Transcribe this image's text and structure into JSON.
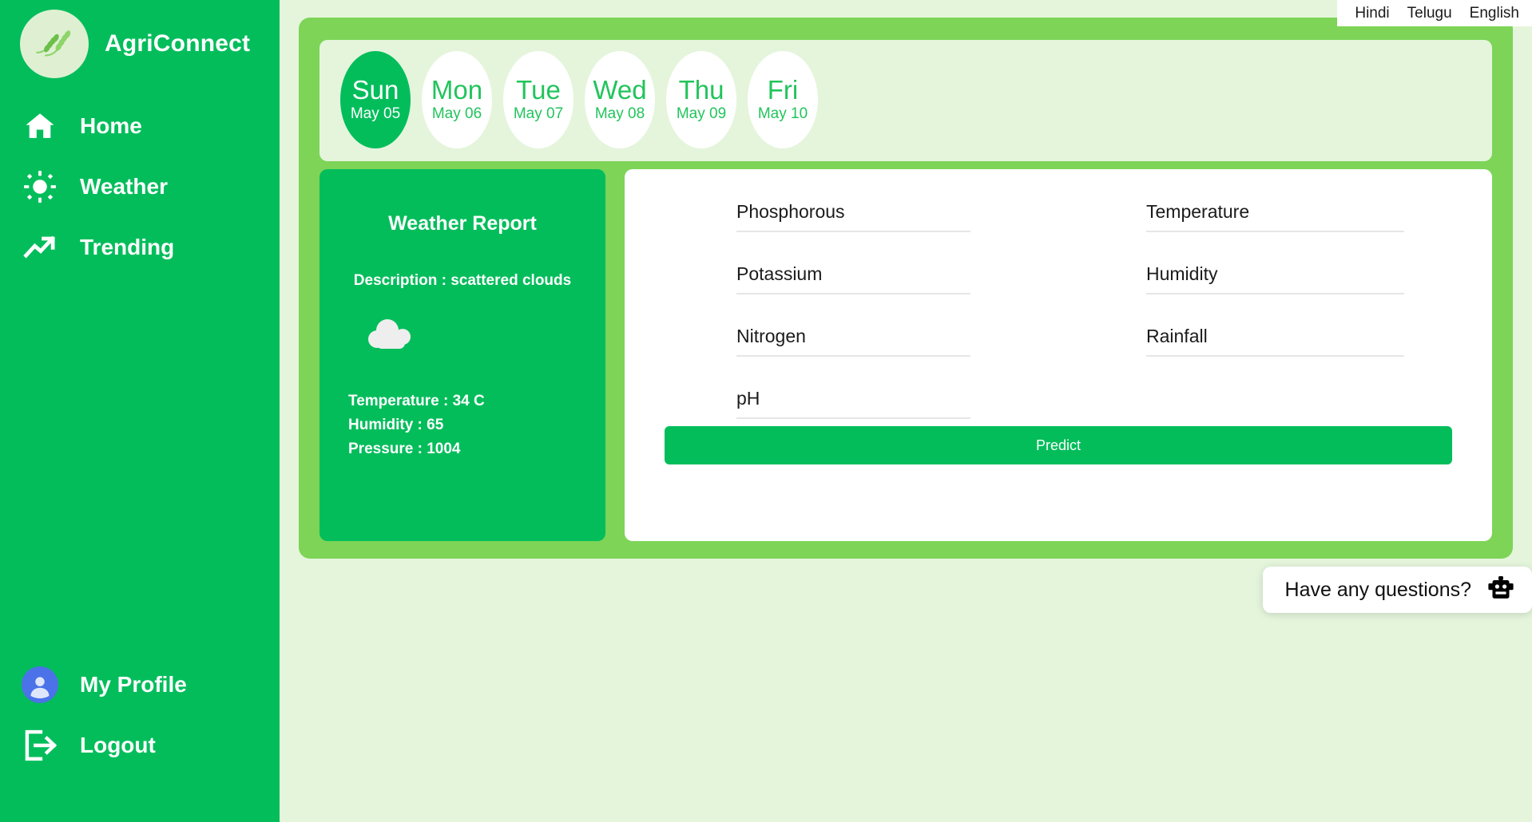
{
  "brand": {
    "name": "AgriConnect",
    "logo_icon": "wheat-logo-icon"
  },
  "sidebar": {
    "items": [
      {
        "label": "Home",
        "icon": "home-icon"
      },
      {
        "label": "Weather",
        "icon": "sun-icon"
      },
      {
        "label": "Trending",
        "icon": "trending-up-icon"
      }
    ],
    "bottom_items": [
      {
        "label": "My Profile",
        "icon": "user-avatar-icon"
      },
      {
        "label": "Logout",
        "icon": "logout-icon"
      }
    ]
  },
  "languages": [
    {
      "label": "Hindi"
    },
    {
      "label": "Telugu"
    },
    {
      "label": "English"
    }
  ],
  "days": [
    {
      "name": "Sun",
      "date": "May 05",
      "active": true
    },
    {
      "name": "Mon",
      "date": "May 06",
      "active": false
    },
    {
      "name": "Tue",
      "date": "May 07",
      "active": false
    },
    {
      "name": "Wed",
      "date": "May 08",
      "active": false
    },
    {
      "name": "Thu",
      "date": "May 09",
      "active": false
    },
    {
      "name": "Fri",
      "date": "May 10",
      "active": false
    }
  ],
  "weather_card": {
    "title": "Weather Report",
    "description": "Description : scattered clouds",
    "icon": "cloud-icon",
    "temperature": "Temperature : 34 C",
    "humidity": "Humidity : 65",
    "pressure": "Pressure : 1004"
  },
  "form": {
    "left_fields": [
      {
        "placeholder": "Phosphorous",
        "value": ""
      },
      {
        "placeholder": "Potassium",
        "value": ""
      },
      {
        "placeholder": "Nitrogen",
        "value": ""
      },
      {
        "placeholder": "pH",
        "value": ""
      }
    ],
    "right_fields": [
      {
        "placeholder": "Temperature",
        "value": ""
      },
      {
        "placeholder": "Humidity",
        "value": ""
      },
      {
        "placeholder": "Rainfall",
        "value": ""
      }
    ],
    "submit_label": "Predict"
  },
  "chat": {
    "text": "Have any questions?",
    "icon": "robot-icon"
  },
  "colors": {
    "sidebar_green": "#03bd5b",
    "panel_green": "#7dd457",
    "page_background": "#e4f5dc",
    "accent": "#03bd5b",
    "card_white": "#ffffff"
  }
}
